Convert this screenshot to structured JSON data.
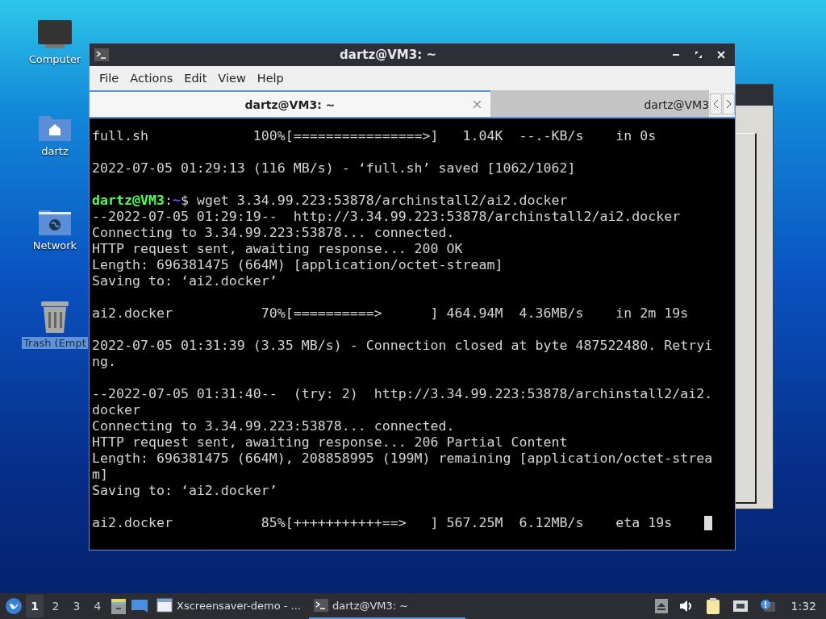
{
  "desktop_icons": [
    {
      "label": "Computer",
      "kind": "computer",
      "selected": false
    },
    {
      "label": "dartz",
      "kind": "home",
      "selected": false
    },
    {
      "label": "Network",
      "kind": "network",
      "selected": false
    },
    {
      "label": "Trash (Empt",
      "kind": "trash",
      "selected": true
    }
  ],
  "terminal_window": {
    "title": "dartz@VM3: ~",
    "menu": [
      "File",
      "Actions",
      "Edit",
      "View",
      "Help"
    ],
    "tabs": [
      {
        "label": "dartz@VM3: ~",
        "selected": true
      },
      {
        "label": "dartz@VM3",
        "selected": false
      }
    ],
    "cursor_visible": true,
    "lines": [
      {
        "kind": "text",
        "text": "full.sh             100%[================>]   1.04K  --.-KB/s    in 0s"
      },
      {
        "kind": "blank"
      },
      {
        "kind": "text",
        "text": "2022-07-05 01:29:13 (116 MB/s) - ‘full.sh’ saved [1062/1062]"
      },
      {
        "kind": "blank"
      },
      {
        "kind": "prompt",
        "user_host": "dartz@VM3",
        "sep": ":",
        "path": "~",
        "command": "$ wget 3.34.99.223:53878/archinstall2/ai2.docker"
      },
      {
        "kind": "text",
        "text": "--2022-07-05 01:29:19--  http://3.34.99.223:53878/archinstall2/ai2.docker"
      },
      {
        "kind": "text",
        "text": "Connecting to 3.34.99.223:53878... connected."
      },
      {
        "kind": "text",
        "text": "HTTP request sent, awaiting response... 200 OK"
      },
      {
        "kind": "text",
        "text": "Length: 696381475 (664M) [application/octet-stream]"
      },
      {
        "kind": "text",
        "text": "Saving to: ‘ai2.docker’"
      },
      {
        "kind": "blank"
      },
      {
        "kind": "text",
        "text": "ai2.docker           70%[==========>      ] 464.94M  4.36MB/s    in 2m 19s"
      },
      {
        "kind": "blank"
      },
      {
        "kind": "text",
        "text": "2022-07-05 01:31:39 (3.35 MB/s) - Connection closed at byte 487522480. Retryi"
      },
      {
        "kind": "text",
        "text": "ng."
      },
      {
        "kind": "blank"
      },
      {
        "kind": "text",
        "text": "--2022-07-05 01:31:40--  (try: 2)  http://3.34.99.223:53878/archinstall2/ai2."
      },
      {
        "kind": "text",
        "text": "docker"
      },
      {
        "kind": "text",
        "text": "Connecting to 3.34.99.223:53878... connected."
      },
      {
        "kind": "text",
        "text": "HTTP request sent, awaiting response... 206 Partial Content"
      },
      {
        "kind": "text",
        "text": "Length: 696381475 (664M), 208858995 (199M) remaining [application/octet-strea"
      },
      {
        "kind": "text",
        "text": "m]"
      },
      {
        "kind": "text",
        "text": "Saving to: ‘ai2.docker’"
      },
      {
        "kind": "blank"
      },
      {
        "kind": "text",
        "text": "ai2.docker           85%[+++++++++++==>   ] 567.25M  6.12MB/s    eta 19s    "
      }
    ]
  },
  "taskbar": {
    "workspaces": [
      {
        "label": "1",
        "selected": true
      },
      {
        "label": "2",
        "selected": false
      },
      {
        "label": "3",
        "selected": false
      },
      {
        "label": "4",
        "selected": false
      }
    ],
    "tasks": [
      {
        "label": "Xscreensaver-demo - ...",
        "kind": "window",
        "selected": false
      },
      {
        "label": "dartz@VM3: ~",
        "kind": "terminal",
        "selected": true
      }
    ],
    "clock": "1:32"
  }
}
